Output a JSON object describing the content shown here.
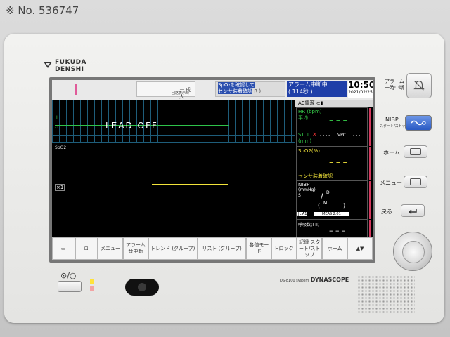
{
  "catalog_no": "※ No. 536747",
  "brand": {
    "line1": "FUKUDA",
    "line2": "DENSHI"
  },
  "model": {
    "series": "DS-8100 system",
    "name": "DYNASCOPE"
  },
  "top_bar": {
    "seg1": "－ 成人",
    "seg2": "回路表示時",
    "spo2_msg_line1": "SpO₂を確認して",
    "spo2_msg_line2": "センサ装着確認",
    "spo2_msg_suffix": "R )",
    "alarm_line1": "アラーム中断中",
    "alarm_line2": "( 114秒 )",
    "time": "10:50",
    "date": "2021/02/25"
  },
  "waveform": {
    "lead_off_text": "LEAD OFF",
    "ecg_label_top": "II",
    "ecg_label_bottom": "-1",
    "spo2_label": "SpO2",
    "scale_label": "×1"
  },
  "right_panel": {
    "ac_header": "AC電源",
    "hr": {
      "label": "HR (bpm)",
      "sub": "平均",
      "value": "– – –",
      "st_label": "ST",
      "st_lead": "II",
      "st_unit": "(mm)",
      "st_value": "- - - -",
      "vpc_label": "VPC",
      "vpc_value": "- - -"
    },
    "spo2": {
      "label": "SpO2(%)",
      "value": "– – –",
      "status": "センサ装着確認"
    },
    "nibp": {
      "label": "NIBP",
      "unit": "(mmHg)",
      "s_label": "S",
      "d_label": "D",
      "m_label": "M",
      "slash": "/",
      "paren_open": "(",
      "paren_close": ")",
      "footer_left": "JL A1",
      "footer_right": "MEAS 2.01"
    },
    "resp": {
      "label": "呼吸数(I-II)",
      "value": "– – –"
    }
  },
  "softkeys": [
    "",
    "",
    "メニュー",
    "アラーム音中断",
    "トレンド (グループ)",
    "リスト (グループ)",
    "各値モード",
    "Hロック",
    "記録 スタート/ストップ",
    "ホーム",
    "▲▼"
  ],
  "hard_buttons": {
    "alarm_pause": "アラーム 一時中断",
    "nibp_start_line1": "NIBP",
    "nibp_start_line2": "スタート/ストップ",
    "home": "ホーム",
    "menu": "メニュー",
    "back": "戻る"
  },
  "icons": {
    "alarm": "bell-off-icon",
    "power": "power-icon",
    "nibp": "cuff-icon",
    "back": "return-arrow-icon"
  },
  "colors": {
    "ecg": "#2ec24a",
    "spo2": "#f2e33a",
    "alarm_bg": "#1f3fa8",
    "alert_bar": "#d6395f"
  }
}
